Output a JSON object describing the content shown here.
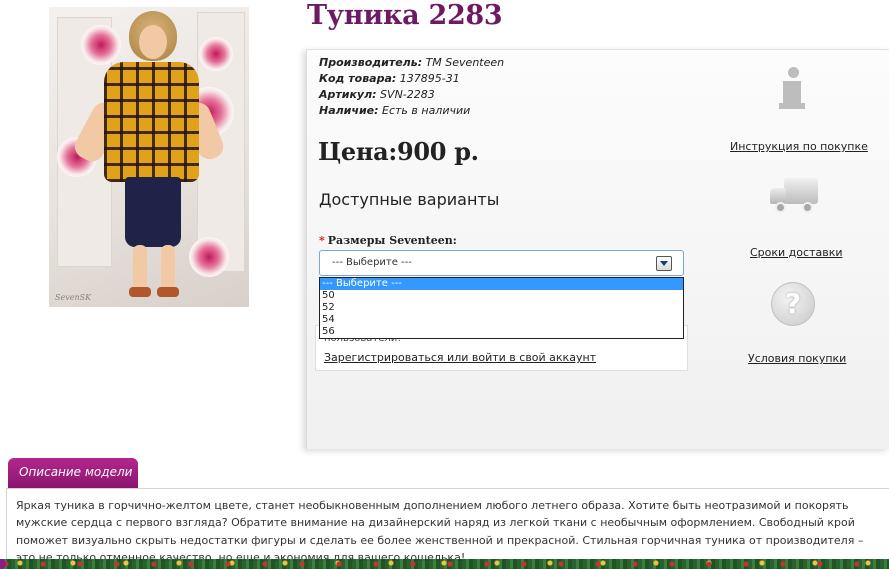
{
  "product": {
    "title": "Туника 2283",
    "photo_signature": "SevenSK",
    "specs": [
      {
        "label": "Производитель:",
        "value": " TM Seventeen"
      },
      {
        "label": "Код товара:",
        "value": " 137895-31"
      },
      {
        "label": "Артикул:",
        "value": " SVN-2283"
      },
      {
        "label": "Наличие:",
        "value": " Есть в наличии"
      }
    ],
    "price": "Цена:900 р."
  },
  "options": {
    "title": "Доступные варианты",
    "required_mark": "*",
    "size_label": "Размеры Seventeen:",
    "select_value": "--- Выберите ---",
    "dropdown_options": [
      "--- Выберите ---",
      "50",
      "52",
      "54",
      "56"
    ],
    "highlighted_index": 0
  },
  "login": {
    "partial_text": "пользователи!",
    "link": "Зарегистрироваться или войти в свой аккаунт"
  },
  "side_links": {
    "instructions": "Инструкция по покупке",
    "delivery": "Сроки доставки",
    "terms": "Условия покупки"
  },
  "icons": [
    "info-icon",
    "truck-icon",
    "question-icon",
    "select-arrow-icon"
  ],
  "colors": {
    "title": "#6b1a63",
    "tab": "#a0207f",
    "dropdown_highlight": "#3399ff",
    "required": "#d31919"
  },
  "description": {
    "tab_label": "Описание модели",
    "text": "Яркая туника в горчично-желтом цвете, станет необыкновенным дополнением любого летнего образа. Хотите быть неотразимой и покорять мужские сердца с первого взгляда? Обратите внимание на дизайнерский наряд из легкой ткани с необычным оформлением. Свободный крой поможет визуально скрыть недостатки фигуры и сделать ее более женственной и прекрасной. Стильная горчичная туника от производителя – это не только отменное качество, но еще и экономия для вашего кошелька!"
  }
}
